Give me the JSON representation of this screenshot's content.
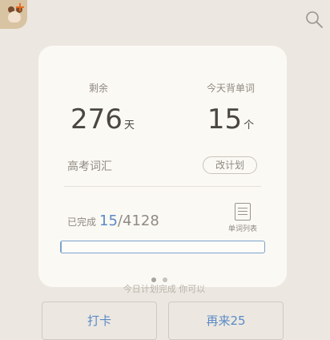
{
  "header": {
    "avatar_icon": "dog-avatar-icon",
    "search_icon": "search-icon"
  },
  "card": {
    "remaining_label": "剩余",
    "remaining_value": "276",
    "remaining_unit": "天",
    "today_label": "今天背单词",
    "today_value": "15",
    "today_unit": "个",
    "plan_name": "高考词汇",
    "change_plan_label": "改计划",
    "done_label": "已完成",
    "done_count": "15",
    "done_total": "/4128",
    "wordlist_label": "单词列表",
    "progress_fraction": 0.0036
  },
  "pager": {
    "count": 2,
    "active": 0
  },
  "footer": {
    "hint": "今日计划完成 你可以",
    "checkin_label": "打卡",
    "more_label": "再来25"
  },
  "colors": {
    "accent": "#5b8ac6",
    "background": "#ece8e1",
    "card": "#fbf9f4"
  }
}
